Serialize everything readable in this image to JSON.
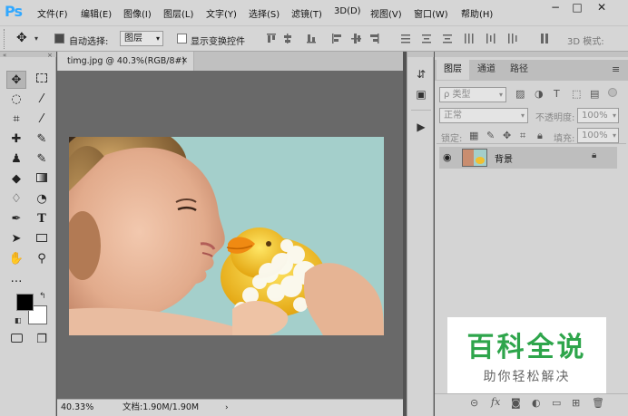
{
  "app": {
    "logo": "Ps"
  },
  "menu": {
    "items": [
      "文件(F)",
      "编辑(E)",
      "图像(I)",
      "图层(L)",
      "文字(Y)",
      "选择(S)",
      "滤镜(T)",
      "3D(D)",
      "视图(V)",
      "窗口(W)",
      "帮助(H)"
    ]
  },
  "window_controls": {
    "minimize": "−",
    "maximize": "□",
    "close": "✕"
  },
  "options": {
    "auto_select_label": "自动选择:",
    "auto_select_checked": true,
    "auto_select_value": "图层",
    "show_transform_label": "显示变换控件",
    "show_transform_checked": false,
    "mode_3d_label": "3D 模式:"
  },
  "document": {
    "tab_title": "timg.jpg @ 40.3%(RGB/8#)",
    "zoom": "40.33%",
    "doc_size": "文档:1.90M/1.90M"
  },
  "layers_panel": {
    "tabs": [
      "图层",
      "通道",
      "路径"
    ],
    "active_tab": "图层",
    "filter_label": "ρ 类型",
    "blend_mode": "正常",
    "opacity_label": "不透明度:",
    "opacity_value": "100%",
    "lock_label": "锁定:",
    "fill_label": "填充:",
    "fill_value": "100%",
    "layer_name": "背景"
  },
  "watermark": {
    "title": "百科全说",
    "subtitle": "助你轻松解决"
  },
  "colors": {
    "ps_blue": "#31a8ff",
    "foreground": "#000000",
    "background": "#ffffff",
    "photo_bg": "#a4cfcb",
    "watermark_green": "#2ea54b"
  }
}
